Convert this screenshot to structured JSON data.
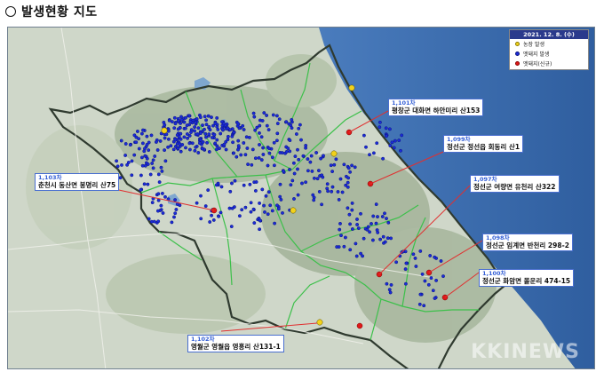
{
  "heading": {
    "text": "발생현황 지도"
  },
  "legend": {
    "date": "2021. 12. 8. (수)",
    "items": [
      {
        "label": "농장 발생",
        "color": "#f2d21a",
        "border": "#8a7a00"
      },
      {
        "label": "멧돼지 발생",
        "color": "#1b2bd8",
        "border": "#0b1480"
      },
      {
        "label": "멧돼지(신규)",
        "color": "#e01818",
        "border": "#8a0000"
      }
    ]
  },
  "callouts": [
    {
      "num": "1,101차",
      "loc": "평창군 대화면 하안미리 산153"
    },
    {
      "num": "1,099차",
      "loc": "정선군 정선읍 회동리 산1"
    },
    {
      "num": "1,103차",
      "loc": "춘천시 동산면 봉명리 산75"
    },
    {
      "num": "1,097차",
      "loc": "정선군 여량면 유천리 산322"
    },
    {
      "num": "1,098차",
      "loc": "정선군 임계면 반천리 298-2"
    },
    {
      "num": "1,100차",
      "loc": "정선군 화암면 몰운리 474-15"
    },
    {
      "num": "1,102차",
      "loc": "영월군 영월읍 영흥리 산131-1"
    }
  ],
  "watermark": "KKINEWS",
  "colors": {
    "sea": "#3f6fb0",
    "land": "#cfd7c9",
    "mountain": "#a9b99f",
    "province_border": "#2f3a2f",
    "district_border": "#3cc04a",
    "callout_line": "#e03030",
    "callout_border": "#4a6fd0",
    "callout_number": "#3560d6"
  }
}
